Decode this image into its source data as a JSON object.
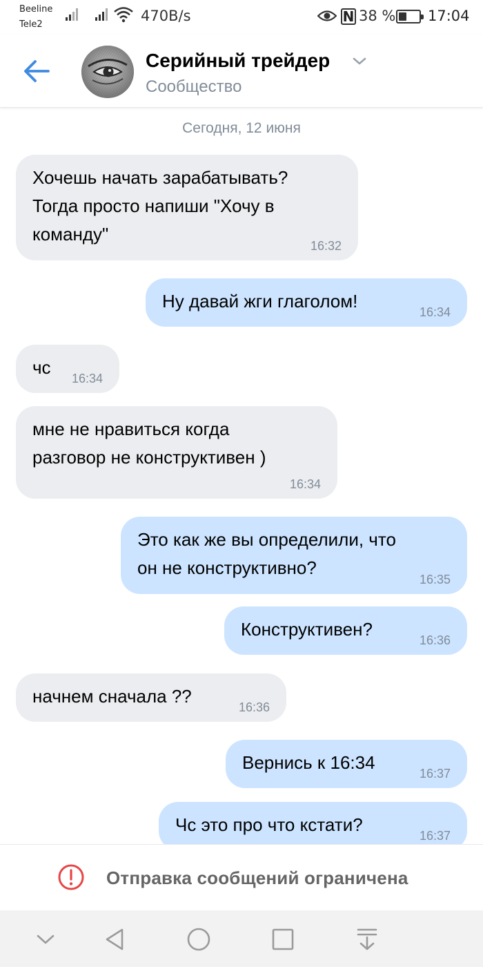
{
  "status_bar": {
    "carrier_1": "Beeline",
    "carrier_2": "Tele2",
    "net_speed": "470B/s",
    "nfc": "N",
    "battery_percent": "38 %",
    "battery_level": 0.38,
    "time": "17:04"
  },
  "header": {
    "title": "Серийный трейдер",
    "subtitle": "Сообщество",
    "back_icon": "arrow-left-icon",
    "chevron_icon": "chevron-down-icon"
  },
  "chat": {
    "date_label": "Сегодня, 12 июня",
    "messages": [
      {
        "dir": "in",
        "text": "Хочешь начать зарабатывать?\nТогда просто напиши \"Хочу в\nкоманду\"",
        "time": "16:32"
      },
      {
        "dir": "out",
        "text": "Ну давай жги глаголом!",
        "time": "16:34"
      },
      {
        "dir": "in",
        "text": "чс",
        "time": "16:34"
      },
      {
        "dir": "in",
        "text": "мне не нравиться когда\nразговор не конструктивен )",
        "time": "16:34"
      },
      {
        "dir": "out",
        "text": "Это как же вы определили, что\nон не конструктивно?",
        "time": "16:35"
      },
      {
        "dir": "out",
        "text": "Конструктивен?",
        "time": "16:36"
      },
      {
        "dir": "in",
        "text": "начнем сначала ??",
        "time": "16:36"
      },
      {
        "dir": "out",
        "text": "Вернись к 16:34",
        "time": "16:37"
      },
      {
        "dir": "out",
        "text": "Чс это про что кстати?",
        "time": "16:37"
      }
    ]
  },
  "footer": {
    "warning_icon": "exclamation-circle-icon",
    "text": "Отправка сообщений ограничена"
  },
  "colors": {
    "accent": "#3f8ae0",
    "incoming_bubble": "#ebedf0",
    "outgoing_bubble": "#cce4ff",
    "secondary_text": "#818c99",
    "warning": "#e64646"
  },
  "nav_bar": {
    "buttons": [
      "chevron-down-icon",
      "back-triangle-icon",
      "home-circle-icon",
      "recents-square-icon",
      "notifications-pull-icon"
    ]
  }
}
